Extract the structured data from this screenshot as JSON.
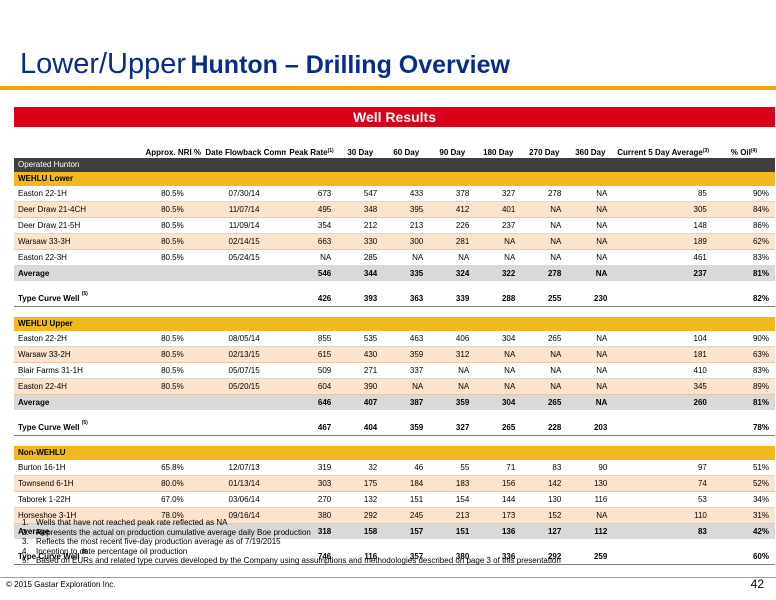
{
  "title": {
    "part1": "Lower/Upper",
    "part2": "Hunton – Drilling Overview"
  },
  "banner": "Well Results",
  "columns": [
    {
      "label": "",
      "sup": ""
    },
    {
      "label": "Approx. NRI %",
      "sup": ""
    },
    {
      "label": "Date Flowback Commenced",
      "sup": ""
    },
    {
      "label": "Peak Rate",
      "sup": "(1)"
    },
    {
      "label": "30 Day",
      "sup": ""
    },
    {
      "label": "60 Day",
      "sup": ""
    },
    {
      "label": "90 Day",
      "sup": ""
    },
    {
      "label": "180 Day",
      "sup": ""
    },
    {
      "label": "270 Day",
      "sup": ""
    },
    {
      "label": "360 Day",
      "sup": ""
    },
    {
      "label": "Current 5 Day Average",
      "sup": "(3)"
    },
    {
      "label": "% Oil",
      "sup": "(4)"
    }
  ],
  "operated_label": "Operated Hunton",
  "sections": [
    {
      "name": "WEHLU Lower",
      "wells": [
        {
          "cells": [
            "Easton 22-1H",
            "80.5%",
            "07/30/14",
            "673",
            "547",
            "433",
            "378",
            "327",
            "278",
            "NA",
            "85",
            "90%"
          ]
        },
        {
          "cells": [
            "Deer Draw 21-4CH",
            "80.5%",
            "11/07/14",
            "495",
            "348",
            "395",
            "412",
            "401",
            "NA",
            "NA",
            "305",
            "84%"
          ]
        },
        {
          "cells": [
            "Deer Draw 21-5H",
            "80.5%",
            "11/09/14",
            "354",
            "212",
            "213",
            "226",
            "237",
            "NA",
            "NA",
            "148",
            "86%"
          ]
        },
        {
          "cells": [
            "Warsaw 33-3H",
            "80.5%",
            "02/14/15",
            "663",
            "330",
            "300",
            "281",
            "NA",
            "NA",
            "NA",
            "189",
            "62%"
          ]
        },
        {
          "cells": [
            "Easton 22-3H",
            "80.5%",
            "05/24/15",
            "NA",
            "285",
            "NA",
            "NA",
            "NA",
            "NA",
            "NA",
            "461",
            "83%"
          ]
        }
      ],
      "average": [
        "Average",
        "",
        "",
        "546",
        "344",
        "335",
        "324",
        "322",
        "278",
        "NA",
        "237",
        "81%"
      ],
      "type_curve": [
        "Type Curve Well",
        "",
        "",
        "426",
        "393",
        "363",
        "339",
        "288",
        "255",
        "230",
        "",
        "82%"
      ]
    },
    {
      "name": "WEHLU Upper",
      "wells": [
        {
          "cells": [
            "Easton 22-2H",
            "80.5%",
            "08/05/14",
            "855",
            "535",
            "463",
            "406",
            "304",
            "265",
            "NA",
            "104",
            "90%"
          ]
        },
        {
          "cells": [
            "Warsaw 33-2H",
            "80.5%",
            "02/13/15",
            "615",
            "430",
            "359",
            "312",
            "NA",
            "NA",
            "NA",
            "181",
            "63%"
          ]
        },
        {
          "cells": [
            "Blair Farms 31-1H",
            "80.5%",
            "05/07/15",
            "509",
            "271",
            "337",
            "NA",
            "NA",
            "NA",
            "NA",
            "410",
            "83%"
          ]
        },
        {
          "cells": [
            "Easton 22-4H",
            "80.5%",
            "05/20/15",
            "604",
            "390",
            "NA",
            "NA",
            "NA",
            "NA",
            "NA",
            "345",
            "89%"
          ]
        }
      ],
      "average": [
        "Average",
        "",
        "",
        "646",
        "407",
        "387",
        "359",
        "304",
        "265",
        "NA",
        "260",
        "81%"
      ],
      "type_curve": [
        "Type Curve Well",
        "",
        "",
        "467",
        "404",
        "359",
        "327",
        "265",
        "228",
        "203",
        "",
        "78%"
      ]
    },
    {
      "name": "Non-WEHLU",
      "wells": [
        {
          "cells": [
            "Burton 16-1H",
            "65.8%",
            "12/07/13",
            "319",
            "32",
            "46",
            "55",
            "71",
            "83",
            "90",
            "97",
            "51%"
          ]
        },
        {
          "cells": [
            "Townsend 6-1H",
            "80.0%",
            "01/13/14",
            "303",
            "175",
            "184",
            "183",
            "156",
            "142",
            "130",
            "74",
            "52%"
          ]
        },
        {
          "cells": [
            "Taborek 1-22H",
            "67.0%",
            "03/06/14",
            "270",
            "132",
            "151",
            "154",
            "144",
            "130",
            "116",
            "53",
            "34%"
          ]
        },
        {
          "cells": [
            "Horseshoe 3-1H",
            "78.0%",
            "09/16/14",
            "380",
            "292",
            "245",
            "213",
            "173",
            "152",
            "NA",
            "110",
            "31%"
          ]
        }
      ],
      "average": [
        "Average",
        "",
        "",
        "318",
        "158",
        "157",
        "151",
        "136",
        "127",
        "112",
        "83",
        "42%"
      ],
      "type_curve": [
        "Type Curve Well",
        "",
        "",
        "746",
        "116",
        "357",
        "380",
        "336",
        "292",
        "259",
        "",
        "60%"
      ]
    }
  ],
  "type_curve_sup": "(5)",
  "notes": [
    "Wells that have not reached peak rate reflected as NA",
    "Represents the actual on production cumulative average daily Boe production",
    "Reflects the most recent five-day production average as of 7/19/2015",
    "Inception to date percentage oil production",
    "Based on EURs and related type curves developed by the Company using assumptions and methodologies described on page 3 of this presentation"
  ],
  "copyright": "© 2015 Gastar Exploration Inc.",
  "page_number": "42",
  "colors": {
    "title": "#0a2a8c",
    "banner": "#d9001b",
    "accent_rule": "#f2a40a",
    "section": "#f2b820",
    "alt_row": "#fbe3cc"
  }
}
